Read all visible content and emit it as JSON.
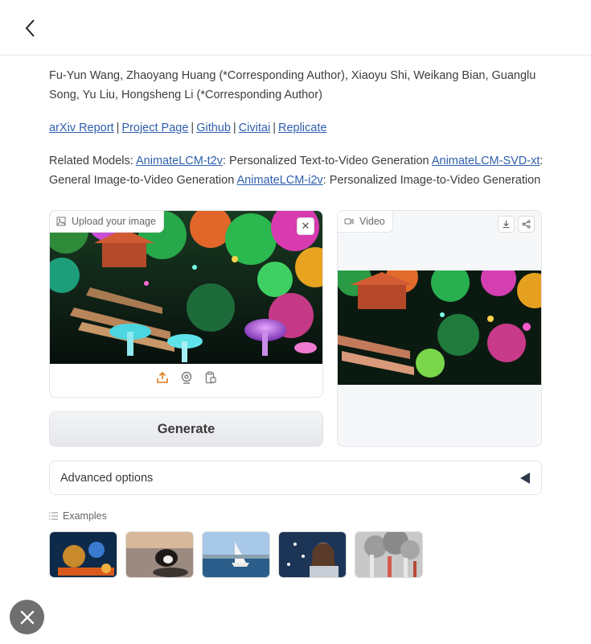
{
  "authors": "Fu-Yun Wang, Zhaoyang Huang (*Corresponding Author), Xiaoyu Shi, Weikang Bian, Guanglu Song, Yu Liu, Hongsheng Li (*Corresponding Author)",
  "links": [
    {
      "label": "arXiv Report"
    },
    {
      "label": "Project Page"
    },
    {
      "label": "Github"
    },
    {
      "label": "Civitai"
    },
    {
      "label": "Replicate"
    }
  ],
  "link_separator": "|",
  "related": {
    "prefix": "Related Models:",
    "items": [
      {
        "link": "AnimateLCM-t2v",
        "desc": ": Personalized Text-to-Video Generation"
      },
      {
        "link": "AnimateLCM-SVD-xt",
        "desc": ": General Image-to-Video Generation"
      },
      {
        "link": "AnimateLCM-i2v",
        "desc": ": Personalized Image-to-Video Generation"
      }
    ]
  },
  "upload": {
    "label": "Upload your image",
    "close": "✕"
  },
  "video": {
    "label": "Video"
  },
  "generate": "Generate",
  "advanced": "Advanced options",
  "examples": {
    "label": "Examples"
  },
  "colors": {
    "link": "#2f5fae",
    "border": "#e3e5e8",
    "upload_icon": "#e07b1a"
  }
}
